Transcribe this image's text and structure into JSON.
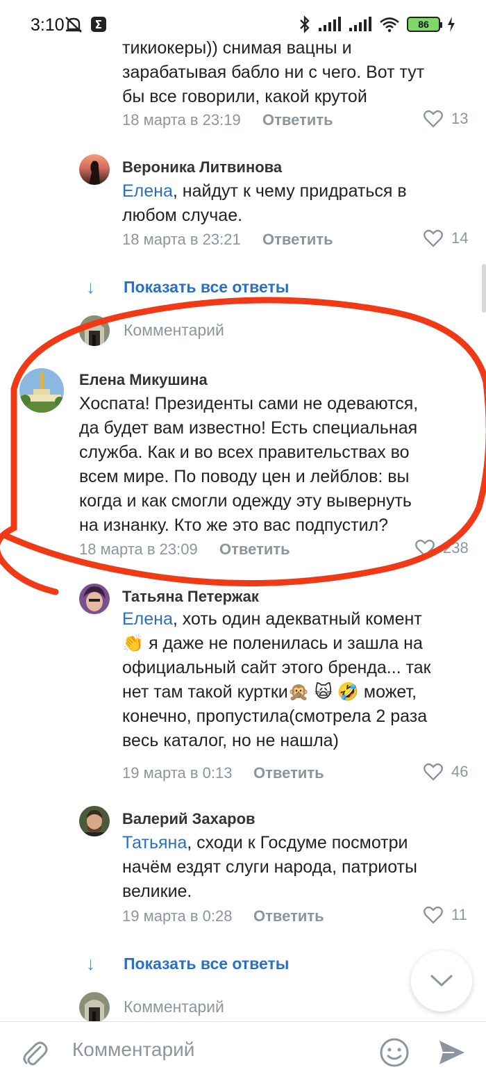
{
  "status_bar": {
    "time": "3:10",
    "battery": "86",
    "icons": [
      "alarm-off-icon",
      "app-icon",
      "bluetooth-icon",
      "signal-icon",
      "signal-icon",
      "wifi-icon",
      "battery-icon",
      "charging-icon"
    ]
  },
  "comments": [
    {
      "text_lines": [
        "тикиокеры)) снимая вацны и",
        "зарабатывая бабло ни с чего. Вот тут",
        "бы все говорили, какой крутой"
      ],
      "date": "18 марта в 23:19",
      "reply": "Ответить",
      "likes": "13"
    },
    {
      "author": "Вероника Литвинова",
      "mention": "Елена",
      "text_first": ", найдут к чему придраться в",
      "text_lines": [
        "любом случае."
      ],
      "date": "18 марта в 23:21",
      "reply": "Ответить",
      "likes": "14"
    },
    {
      "author": "Елена Микушина",
      "text_lines": [
        "Хоспата! Президенты сами не одеваются,",
        "да будет вам известно! Есть специальная",
        "служба. Как и во всех правительствах во",
        "всем мире. По поводу цен и лейблов: вы",
        "когда и как смогли одежду эту вывернуть",
        "на изнанку. Кто же это  вас подпустил?"
      ],
      "date": "18 марта в 23:09",
      "reply": "Ответить",
      "likes": "238"
    },
    {
      "author": "Татьяна Петержак",
      "mention": "Елена",
      "text_first": ", хоть один адекватный комент",
      "text_lines": [
        "👏 я даже не поленилась и зашла на",
        "официальный сайт этого бренда... так",
        "нет там такой куртки🙊 🙀 🤣 может,",
        "конечно, пропустила(смотрела 2 раза",
        "весь каталог, но не нашла)"
      ],
      "date": "19 марта в 0:13",
      "reply": "Ответить",
      "likes": "46"
    },
    {
      "author": "Валерий Захаров",
      "mention": "Татьяна",
      "text_first": ", сходи к Госдуме посмотри",
      "text_lines": [
        "начём ездят слуги народа, патриоты",
        "великие."
      ],
      "date": "19 марта в 0:28",
      "reply": "Ответить",
      "likes": "11"
    }
  ],
  "show_all_replies": "Показать все ответы",
  "comment_prompt": "Комментарий",
  "bottom_bar": {
    "placeholder": "Комментарий"
  },
  "colors": {
    "accent": "#2a6fc4",
    "muted": "#8c959e",
    "annotation_red": "#f03a17"
  }
}
